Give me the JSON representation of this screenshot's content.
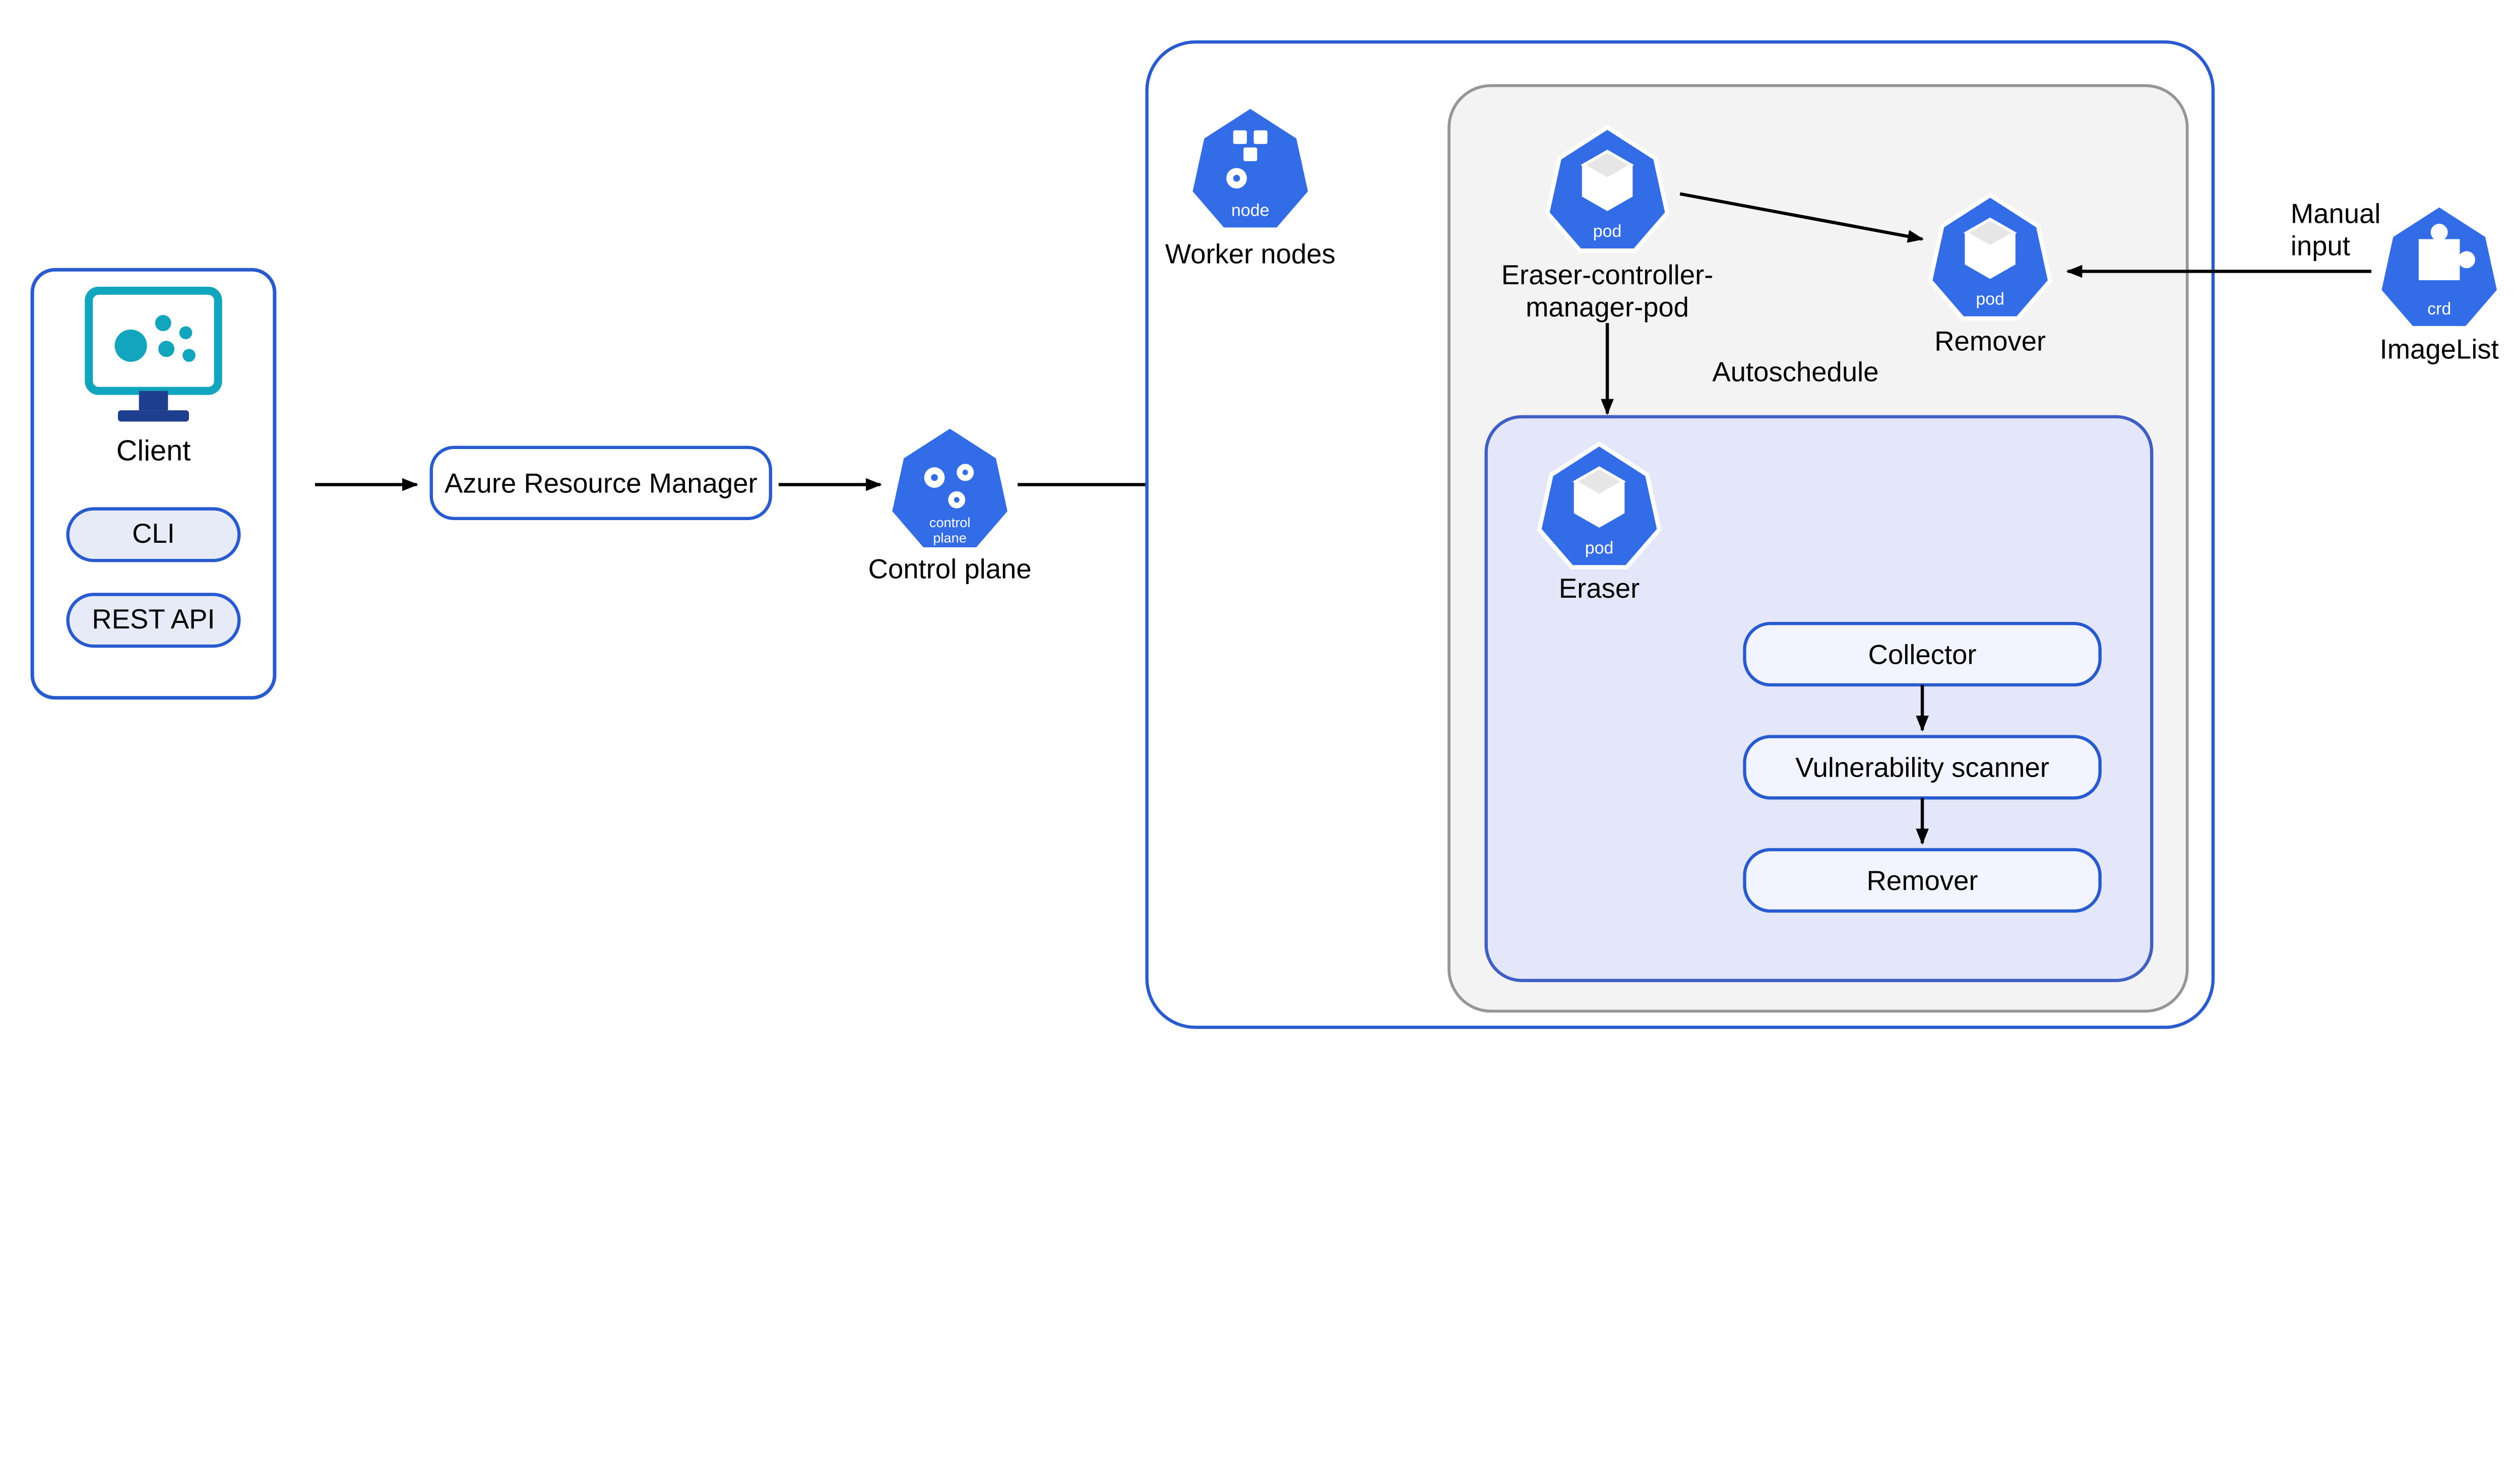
{
  "colors": {
    "azureBlue": "#275bcf",
    "heptagonFill": "#326ce6",
    "lightBlueFill": "#e6ebf7",
    "innerPanelFill": "#e3e7f9",
    "innerPanelStroke": "#3f5fc4",
    "greyPanelFill": "#f3f3f3",
    "greyPanelStroke": "#969696",
    "heptagonStroke": "#ffffff",
    "black": "#000000",
    "darkNavy": "#1e3f8f",
    "monitorCyan": "#12a6be",
    "pillFill": "#f2f5ff"
  },
  "client": {
    "label": "Client",
    "buttons": [
      "CLI",
      "REST API"
    ]
  },
  "arm": {
    "label": "Azure Resource Manager"
  },
  "controlPlane": {
    "badge": "control\nplane",
    "label": "Control plane"
  },
  "workerNodes": {
    "badge": "node",
    "label": "Worker nodes"
  },
  "eraserManager": {
    "badge": "pod",
    "label": "Eraser-controller-\nmanager-pod"
  },
  "remover": {
    "badge": "pod",
    "label": "Remover"
  },
  "eraser": {
    "badge": "pod",
    "label": "Eraser"
  },
  "crd": {
    "badge": "crd",
    "label": "ImageList"
  },
  "autoschedule": "Autoschedule",
  "manualInput": "Manual\ninput",
  "pipeline": [
    "Collector",
    "Vulnerability scanner",
    "Remover"
  ]
}
